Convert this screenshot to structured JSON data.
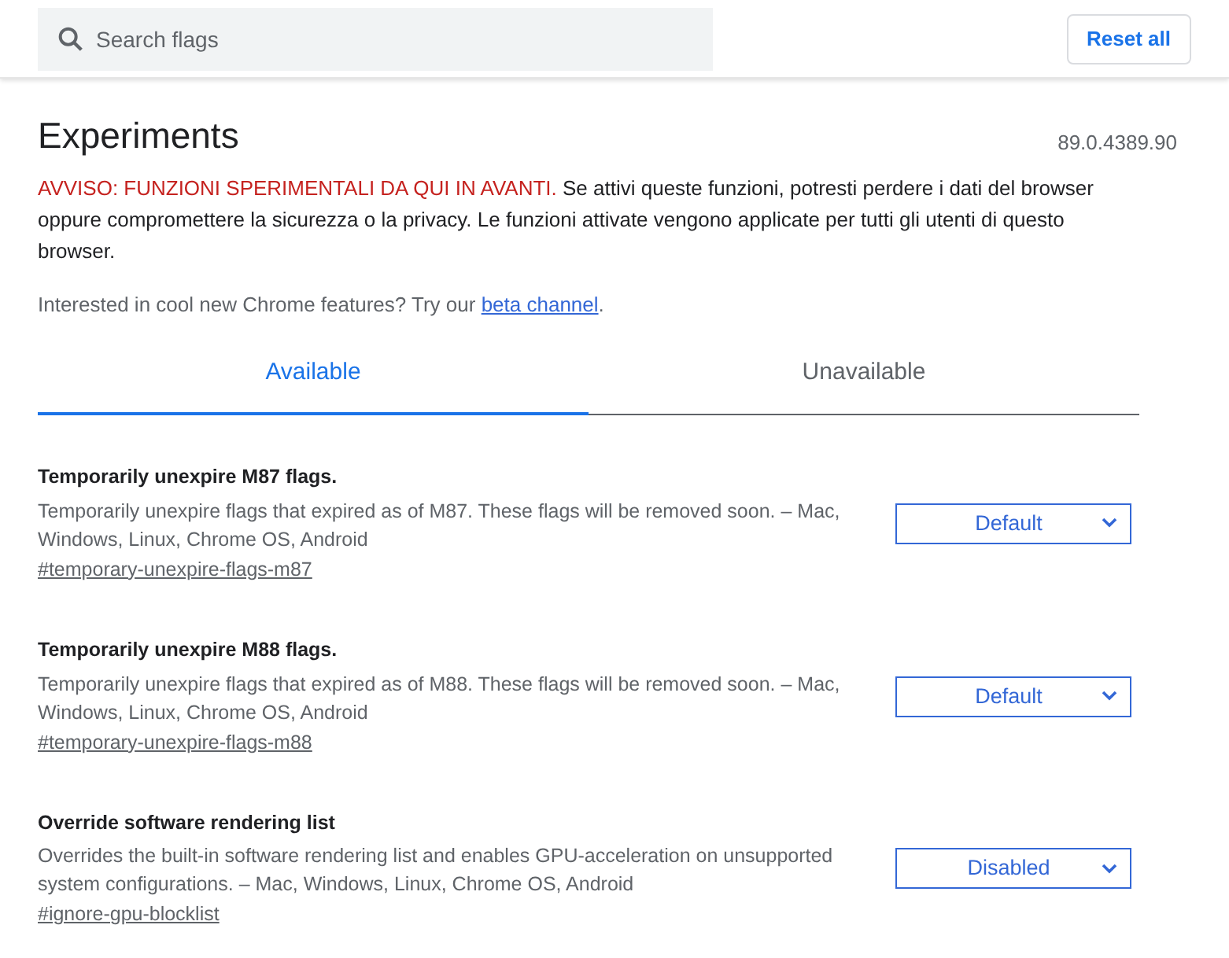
{
  "search": {
    "placeholder": "Search flags"
  },
  "reset_button": "Reset all",
  "title": "Experiments",
  "version": "89.0.4389.90",
  "warning": {
    "alert": "AVVISO: FUNZIONI SPERIMENTALI DA QUI IN AVANTI.",
    "text": "Se attivi queste funzioni, potresti perdere i dati del browser oppure compromettere la sicurezza o la privacy. Le funzioni attivate vengono applicate per tutti gli utenti di questo browser."
  },
  "promo": {
    "text": "Interested in cool new Chrome features? Try our",
    "link": "beta channel",
    "end": "."
  },
  "tabs": [
    {
      "label": "Available",
      "selected": true
    },
    {
      "label": "Unavailable",
      "selected": false
    }
  ],
  "flags": [
    {
      "title": "Temporarily unexpire M87 flags.",
      "description": "Temporarily unexpire flags that expired as of M87. These flags will be removed soon. – Mac, Windows, Linux, Chrome OS, Android",
      "link": "#temporary-unexpire-flags-m87",
      "value": "Default"
    },
    {
      "title": "Temporarily unexpire M88 flags.",
      "description": "Temporarily unexpire flags that expired as of M88. These flags will be removed soon. – Mac, Windows, Linux, Chrome OS, Android",
      "link": "#temporary-unexpire-flags-m88",
      "value": "Default"
    },
    {
      "title": "Override software rendering list",
      "description": "Overrides the built-in software rendering list and enables GPU-acceleration on unsupported system configurations. – Mac, Windows, Linux, Chrome OS, Android",
      "link": "#ignore-gpu-blocklist",
      "value": "Disabled"
    }
  ]
}
